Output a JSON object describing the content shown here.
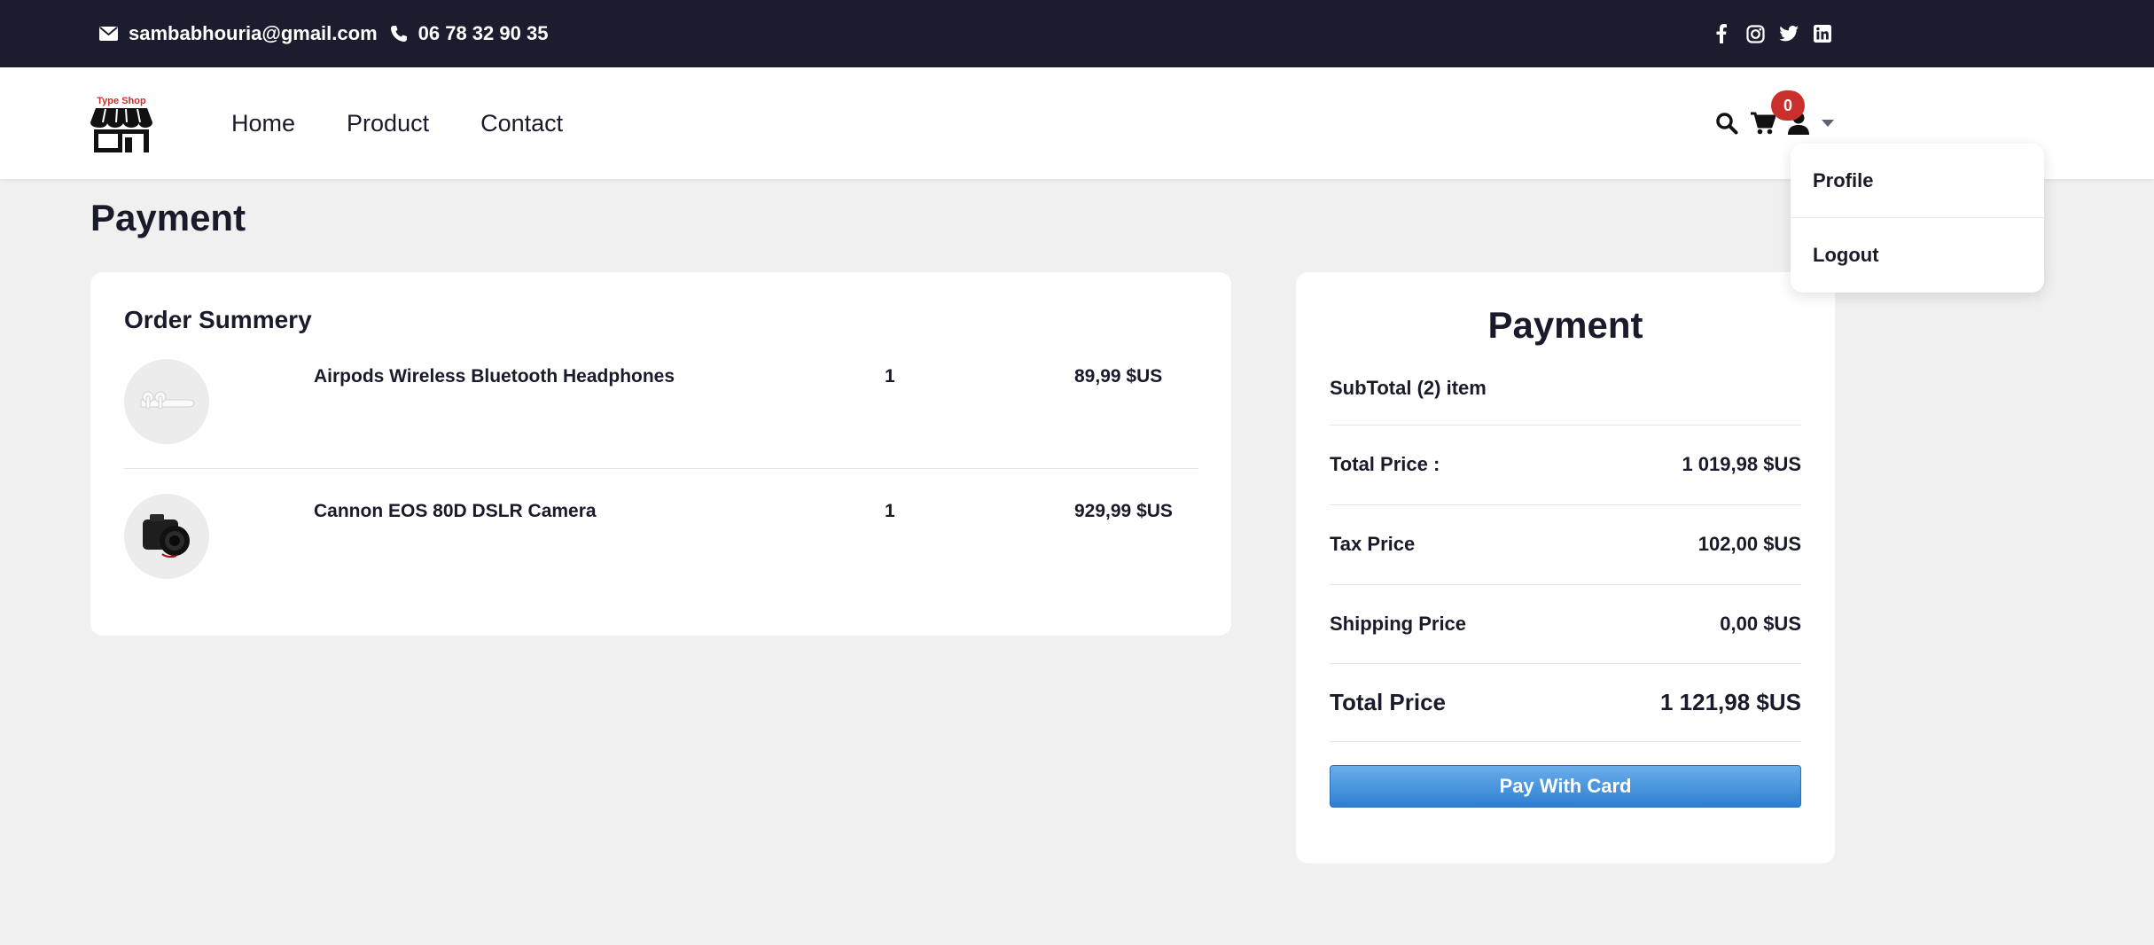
{
  "topbar": {
    "email": "sambabhouria@gmail.com",
    "phone": "06 78 32 90 35",
    "icons": [
      "envelope-icon",
      "phone-icon",
      "facebook-icon",
      "instagram-icon",
      "twitter-icon",
      "linkedin-icon"
    ]
  },
  "navbar": {
    "brand": "Type Shop",
    "links": [
      "Home",
      "Product",
      "Contact"
    ],
    "cart_count": "0",
    "icons": [
      "search-icon",
      "cart-icon",
      "user-icon",
      "caret-down-icon"
    ]
  },
  "dropdown": {
    "items": [
      "Profile",
      "Logout"
    ]
  },
  "page": {
    "title": "Payment"
  },
  "order": {
    "title": "Order Summery",
    "items": [
      {
        "name": "Airpods Wireless Bluetooth Headphones",
        "qty": "1",
        "price": "89,99 $US"
      },
      {
        "name": "Cannon EOS 80D DSLR Camera",
        "qty": "1",
        "price": "929,99 $US"
      }
    ]
  },
  "payment": {
    "title": "Payment",
    "subtotal": "SubTotal (2) item",
    "rows": [
      {
        "label": "Total Price :",
        "value": "1 019,98 $US"
      },
      {
        "label": "Tax Price",
        "value": "102,00 $US"
      },
      {
        "label": "Shipping Price",
        "value": "0,00 $US"
      }
    ],
    "total_label": "Total Price",
    "total_value": "1 121,98 $US",
    "button_label": "Pay With Card"
  },
  "colors": {
    "topbar_bg": "#1b1c2e",
    "badge": "#c9302c",
    "button": "#2e7fd2",
    "page_bg": "#f0f0f0"
  }
}
